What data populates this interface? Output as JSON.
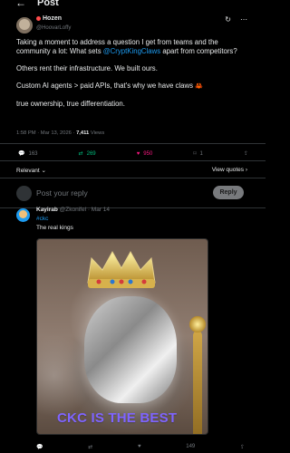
{
  "header": {
    "title": "Post",
    "back_icon": "arrow-left-icon"
  },
  "post": {
    "author": "Hozen",
    "handle": "@HoovarLoffy",
    "body": [
      "Taking a moment to address a question I get from teams and the community a lot: What sets ",
      "@CryptKingClaws",
      " apart from competitors?",
      "Others rent their infrastructure. We built ours.",
      "Custom AI agents > paid APIs, that's why we have claws ",
      "🦀",
      "true ownership, true differentiation."
    ],
    "meta": "1:58 PM · Mar 13, 2026 · ",
    "views_count": "7,411",
    "views_label": " Views",
    "counts": {
      "replies": "163",
      "reposts": "269",
      "likes": "950",
      "bookmarks": "1"
    },
    "filters": {
      "relevant": "Relevant ⌄",
      "view_quotes": "View quotes ›"
    }
  },
  "reply_box": {
    "placeholder": "Post your reply",
    "button": "Reply"
  },
  "comment": {
    "author": "Kayirab",
    "handle": "@Zkonifel · Mar 14",
    "tag": "#ckc",
    "text": "The real kings",
    "image_overlay": "CKC IS THE BEST",
    "footer_counts": {
      "likes": "149"
    }
  },
  "icons": {
    "refresh": "↻",
    "more": "⋯",
    "reply": "💬",
    "repost": "⇄",
    "like": "♥",
    "bookmark": "⌑",
    "share": "⇪"
  },
  "colors": {
    "accent": "#1d9bf0",
    "repost": "#00ba7c",
    "like": "#f91880",
    "background": "#000000"
  }
}
